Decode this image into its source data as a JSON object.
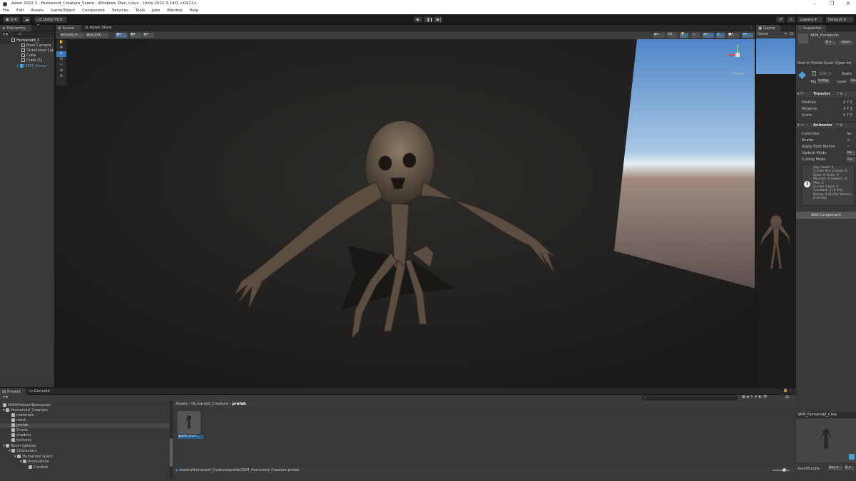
{
  "window": {
    "title": "Asset 2022.3 - Humanoid_Creature_Scene - Windows, Mac, Linux - Unity 2022.3.14f1 <DX11>"
  },
  "menu": [
    "File",
    "Edit",
    "Assets",
    "GameObject",
    "Component",
    "Services",
    "Tools",
    "Jobs",
    "Window",
    "Help"
  ],
  "toolbar": {
    "account": "D",
    "vcs": "Unity VCS",
    "layers": "Layers",
    "layout": "Default"
  },
  "hierarchy": {
    "tab": "Hierarchy",
    "search_placeholder": "All",
    "items": [
      {
        "label": "Humanoid_C"
      },
      {
        "label": "Main Camera"
      },
      {
        "label": "Directional Lig"
      },
      {
        "label": "Cube"
      },
      {
        "label": "Cube (1)"
      },
      {
        "label": "SKM_Huma"
      }
    ]
  },
  "scene": {
    "tabs": [
      "Scene",
      "Asset Store"
    ],
    "pivot": "Center",
    "space": "Local",
    "mode_2d": "2D",
    "gizmo_label": "<Persp"
  },
  "game": {
    "tab": "Game",
    "display": "Game",
    "display2": "Di"
  },
  "inspector": {
    "tab": "Inspector",
    "asset_name": "SKM_Humanoic",
    "open_button": "Open",
    "prefab_note": "Root in Prefab Asset (Open for",
    "object_name": "SKM_H",
    "static": "Static",
    "tag_label": "Tag",
    "tag_value": "Untag",
    "layer_label": "Layer",
    "layer_value": "De",
    "transform": {
      "title": "Transfor",
      "fields": [
        "Position",
        "Rotation",
        "Scale"
      ],
      "axes": "X Y Z"
    },
    "animator": {
      "title": "Animator",
      "fields": [
        {
          "label": "Controller",
          "value": "No"
        },
        {
          "label": "Avatar",
          "value": ""
        },
        {
          "label": "Apply Root Motion",
          "value": "✓"
        },
        {
          "label": "Update Mode",
          "value": "No"
        },
        {
          "label": "Culling Mode",
          "value": "Cu"
        }
      ],
      "info": [
        "Clip Count: 0",
        "Curves Pos: 0 Quat: 0",
        "Euler: 0 Scale: 0",
        "Muscles: 0 Generic: 0",
        "PPtr: 0",
        "Curves Count: 0",
        "Constant: 0 (0.0%)",
        "Dense: 0 (0.0%) Stream:",
        "0 (0.0%)"
      ]
    },
    "add_component": "Add Component",
    "preview_title": "SKM_Humanoid_Crea",
    "assetbundle_label": "AssetBundle",
    "assetbundle_value": "Non",
    "assetbundle_variant": "N"
  },
  "project": {
    "tabs": [
      "Project",
      "Console"
    ],
    "tree": [
      {
        "label": "HDRPDefaultResources",
        "indent": 1
      },
      {
        "label": "Humanoid_Creature",
        "indent": 1
      },
      {
        "label": "materials",
        "indent": 2
      },
      {
        "label": "mesh",
        "indent": 2
      },
      {
        "label": "prefab",
        "indent": 2
      },
      {
        "label": "Scene",
        "indent": 2
      },
      {
        "label": "shaders",
        "indent": 2
      },
      {
        "label": "textures",
        "indent": 2
      },
      {
        "label": "Kevin Iglesias",
        "indent": 1
      },
      {
        "label": "Characters",
        "indent": 2
      },
      {
        "label": "Humanoid Giant",
        "indent": 3
      },
      {
        "label": "Animations",
        "indent": 4
      },
      {
        "label": "Combat",
        "indent": 5
      }
    ],
    "breadcrumb": [
      "Assets",
      "Humanoid_Creature",
      "prefab"
    ],
    "asset_label": "SKM_Hum...",
    "path": "Assets/Humanoid_Creature/prefab/SKM_Humanoid_Creature.prefab",
    "count": "26"
  },
  "colors": {
    "bg": "#191919",
    "panel": "#383838",
    "selection": "#2c5d87",
    "link": "#4c9ed9"
  }
}
